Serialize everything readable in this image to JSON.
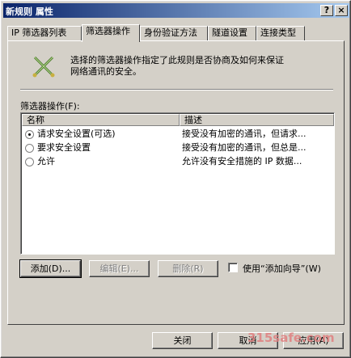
{
  "window": {
    "title": "新规则 属性",
    "help_label": "?",
    "close_label": "×"
  },
  "tabs": [
    {
      "label": "IP 筛选器列表",
      "active": false
    },
    {
      "label": "筛选器操作",
      "active": true
    },
    {
      "label": "身份验证方法",
      "active": false
    },
    {
      "label": "隧道设置",
      "active": false
    },
    {
      "label": "连接类型",
      "active": false
    }
  ],
  "panel": {
    "icon": "filter-action-icon",
    "description_line1": "选择的筛选器操作指定了此规则是否协商及如何来保证",
    "description_line2": "网络通讯的安全。",
    "list_label": "筛选器操作(F):",
    "columns": [
      "名称",
      "描述"
    ],
    "rows": [
      {
        "name": "请求安全设置(可选)",
        "description": "接受没有加密的通讯，但请求...",
        "selected": true
      },
      {
        "name": "要求安全设置",
        "description": "接受没有加密的通讯，但总是...",
        "selected": false
      },
      {
        "name": "允许",
        "description": "允许没有安全措施的 IP 数据...",
        "selected": false
      }
    ],
    "add_button": "添加(D)...",
    "edit_button": "编辑(E)...",
    "remove_button": "删除(R)",
    "wizard_checkbox_label": "使用“添加向导”(W)",
    "wizard_checked": false
  },
  "footer": {
    "close_button": "关闭",
    "cancel_button": "取消",
    "apply_button": "应用(A)"
  },
  "watermark": "315safe.com",
  "colors": {
    "titlebar_start": "#0a246a",
    "titlebar_end": "#a6caf0",
    "face": "#d4d0c8"
  }
}
